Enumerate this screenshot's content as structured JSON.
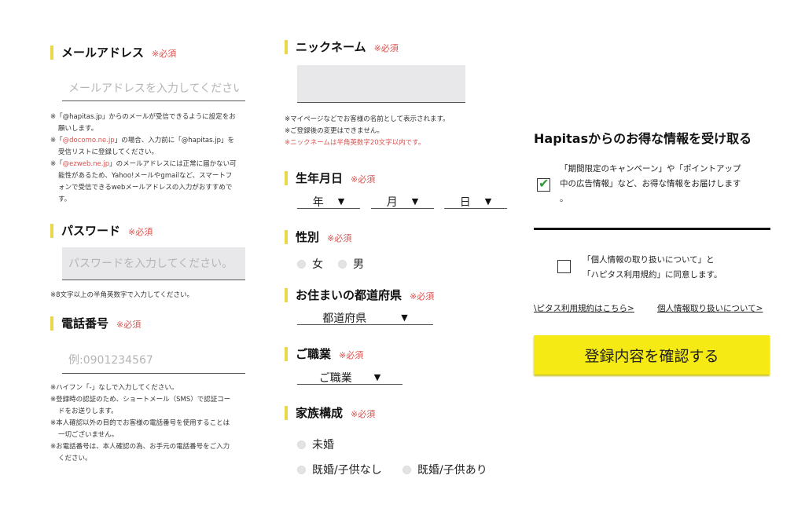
{
  "required_mark": "※必須",
  "email": {
    "label": "メールアドレス",
    "placeholder": "メールアドレスを入力してくださ​い",
    "notes": [
      "※「@hapitas.jp」からのメールが受信できるように設定をお",
      "願いします。",
      "※「",
      "@docomo.ne.jp",
      "」の場合、入力前に「@hapitas.jp」を",
      "受信リストに登録してください。",
      "@ezweb.ne.jp",
      "」のメールアドレスには正常に届かない可",
      "能性があるため、Yahoo!メールやgmailなど、スマートフ",
      "ォンで受信できるwebメールアドレスの入力がおすすめで",
      "す。"
    ]
  },
  "password": {
    "label": "パスワード",
    "placeholder": "パスワードを入力してください。",
    "note": "※8文字以上の半角英数字で入力してください。"
  },
  "phone": {
    "label": "電話番号",
    "placeholder": "例:0901234567",
    "notes": [
      "※ハイフン「-」なしで入力してください。",
      "※登録時の認証のため、ショートメール（SMS）で認証コー",
      "ドをお送りします。",
      "※本人確認以外の目的でお客様の電話番号を使用することは",
      "一切ございません。",
      "※お電話番号は、本人確認の為、お手元の電話番号をご入力",
      "ください。"
    ]
  },
  "nickname": {
    "label": "ニックネーム",
    "value": "",
    "notes": [
      "※マイページなどでお客様の名前として表示されます。",
      "※ご登録後の変更はできません。"
    ],
    "note_red": "※ニックネームは半角英数字20文字以内です。"
  },
  "birthday": {
    "label": "生年月日",
    "year": "年",
    "month": "月",
    "day": "日"
  },
  "gender": {
    "label": "性別",
    "female": "女",
    "male": "男"
  },
  "prefecture": {
    "label": "お住まいの都道府県",
    "selected": "都道府県"
  },
  "occupation": {
    "label": "ご職業",
    "selected": "ご職業"
  },
  "family": {
    "label": "家族構成",
    "opt1": "未婚",
    "opt2": "既婚/子供なし",
    "opt3": "既婚/子供あり"
  },
  "info_section": {
    "heading": "Hapitasからのお得な情報を受け取る",
    "checkbox_line1": "「期間限定のキャンペーン」や「ポイントアップ",
    "checkbox_line2": "中の広告情報」など、お得な情報をお届けします",
    "checkbox_line3": "。",
    "checked": true
  },
  "agreement": {
    "line1": "「個人情報の取り扱いについて」と",
    "line2": "「ハピタス利用規約」に同意します。",
    "checked": false
  },
  "links": {
    "terms": "\\ピタス利用規約はこちら>",
    "privacy": "個人情報取り扱いについて>"
  },
  "submit_label": "登録内容を確認する",
  "arrow_glyph": "▼",
  "check_glyph": "✔",
  "colors": {
    "accent_bar": "#e8d84a",
    "required": "#d9534f",
    "submit_bg": "#f5ea14",
    "check": "#2e9e3a"
  }
}
